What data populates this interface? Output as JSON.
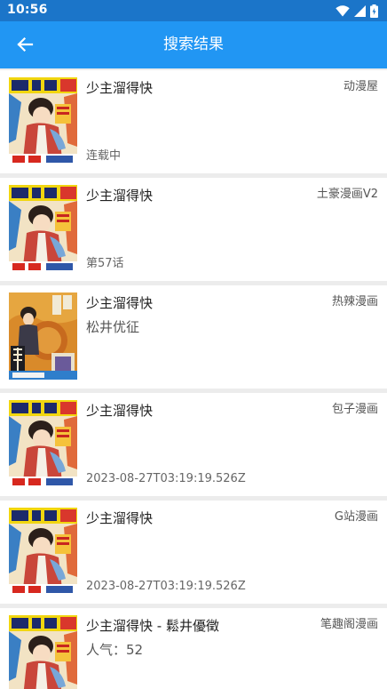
{
  "status_bar": {
    "time": "10:56",
    "icons": [
      "wifi-icon",
      "signal-icon",
      "battery-icon"
    ]
  },
  "app_bar": {
    "title": "搜索结果",
    "back_icon": "arrow-left-icon"
  },
  "colors": {
    "status_bar": "#1b75c9",
    "app_bar": "#2196f3",
    "background": "#ececec",
    "card": "#ffffff"
  },
  "results": [
    {
      "title": "少主溜得快",
      "source": "动漫屋",
      "subtitle": "",
      "status": "连载中",
      "cover": "shonen-jump-cover"
    },
    {
      "title": "少主溜得快",
      "source": "土豪漫画V2",
      "subtitle": "",
      "status": "第57话",
      "cover": "shonen-jump-cover"
    },
    {
      "title": "少主溜得快",
      "source": "热辣漫画",
      "subtitle": "松井优征",
      "status": "",
      "cover": "volume-cover"
    },
    {
      "title": "少主溜得快",
      "source": "包子漫画",
      "subtitle": "",
      "status": "2023-08-27T03:19:19.526Z",
      "cover": "shonen-jump-cover"
    },
    {
      "title": "少主溜得快",
      "source": "G站漫画",
      "subtitle": "",
      "status": "2023-08-27T03:19:19.526Z",
      "cover": "shonen-jump-cover"
    },
    {
      "title": "少主溜得快 - 鬆井優徵",
      "source": "笔趣阁漫画",
      "subtitle": "人气：52",
      "status": "",
      "cover": "shonen-jump-cover"
    }
  ]
}
